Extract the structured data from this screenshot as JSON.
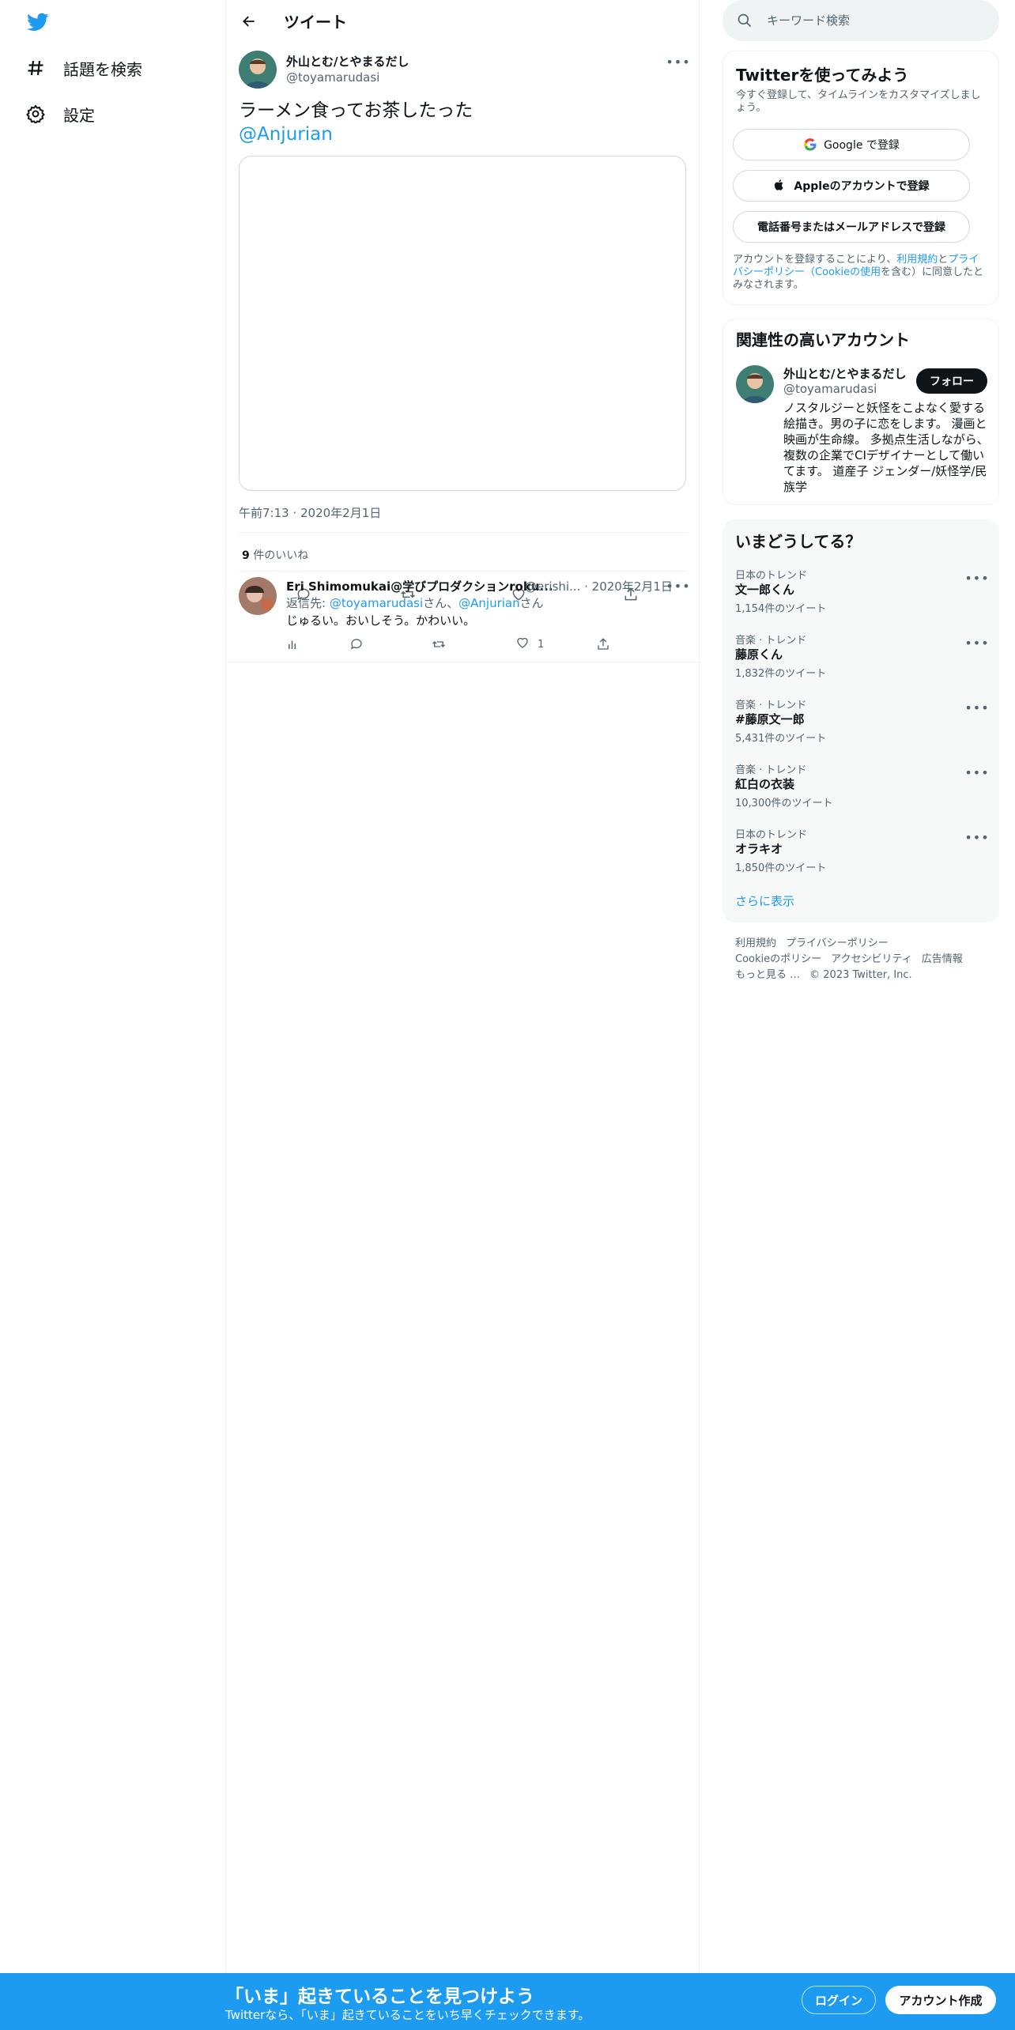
{
  "nav": {
    "logo_icon": "twitter-bird-icon",
    "items": [
      {
        "label": "話題を検索",
        "icon": "hashtag-icon"
      },
      {
        "label": "設定",
        "icon": "gear-icon"
      }
    ]
  },
  "header": {
    "title": "ツイート",
    "back_icon": "arrow-left-icon"
  },
  "tweet": {
    "author_name": "外山とむ/とやまるだし",
    "author_handle": "@toyamarudasi",
    "text": "ラーメン食ってお茶したった",
    "mention": "@Anjurian",
    "timestamp": "午前7:13 · 2020年2月1日",
    "likes_count": "9",
    "likes_label": "件のいいね"
  },
  "reply": {
    "name": "Eri Shimomukai@学びプロダクションroku...",
    "handle_time": "@erishi... · 2020年2月1日",
    "reply_prefix": "返信先: ",
    "reply_user1": "@toyamarudasi",
    "reply_mid": "さん、",
    "reply_user2": "@Anjurian",
    "reply_suffix": "さん",
    "text": "じゅるい。おいしそう。かわいい。",
    "like_count": "1"
  },
  "search": {
    "placeholder": "キーワード検索"
  },
  "signup_card": {
    "title": "Twitterを使ってみよう",
    "subtitle": "今すぐ登録して、タイムラインをカスタマイズしましょう。",
    "google_label": "Google で登録",
    "apple_label": "Appleのアカウントで登録",
    "phone_label": "電話番号またはメールアドレスで登録",
    "terms_prefix": "アカウントを登録することにより、",
    "terms_link1": "利用規約",
    "terms_and": "と",
    "terms_link2": "プライバシーポリシー（Cookieの使用",
    "terms_suffix": "を含む）に同意したとみなされます。"
  },
  "relevant": {
    "title": "関連性の高いアカウント",
    "name": "外山とむ/とやまるだし",
    "handle": "@toyamarudasi",
    "follow_label": "フォロー",
    "bio": "ノスタルジーと妖怪をこよなく愛する絵描き。男の子に恋をします。 漫画と映画が生命線。 多拠点生活しながら、複数の企業でCIデザイナーとして働いてます。 道産子 ジェンダー/妖怪学/民族学"
  },
  "trends": {
    "title": "いまどうしてる？",
    "items": [
      {
        "context": "日本のトレンド",
        "name": "文一郎くん",
        "count": "1,154件のツイート"
      },
      {
        "context": "音楽 · トレンド",
        "name": "藤原くん",
        "count": "1,832件のツイート"
      },
      {
        "context": "音楽 · トレンド",
        "name": "#藤原文一郎",
        "count": "5,431件のツイート"
      },
      {
        "context": "音楽 · トレンド",
        "name": "紅白の衣装",
        "count": "10,300件のツイート"
      },
      {
        "context": "日本のトレンド",
        "name": "オラキオ",
        "count": "1,850件のツイート"
      }
    ],
    "show_more": "さらに表示"
  },
  "footer": {
    "links": [
      "利用規約",
      "プライバシーポリシー",
      "Cookieのポリシー",
      "アクセシビリティ",
      "広告情報",
      "もっと見る …",
      "© 2023 Twitter, Inc."
    ]
  },
  "banner": {
    "title": "「いま」起きていることを見つけよう",
    "subtitle": "Twitterなら、「いま」起きていることをいち早くチェックできます。",
    "login_label": "ログイン",
    "signup_label": "アカウント作成"
  },
  "colors": {
    "accent": "#1d9bf0",
    "text": "#0f1419",
    "muted": "#536471"
  }
}
